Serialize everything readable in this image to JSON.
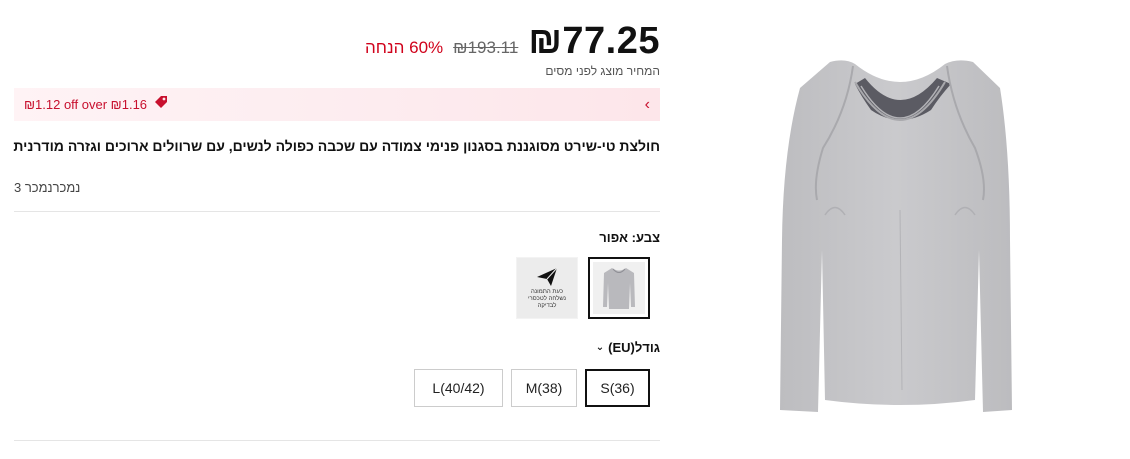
{
  "price": {
    "current": "₪77.25",
    "original": "₪193.11",
    "discount": "60% הנחה",
    "tax_note": "המחיר מוצג לפני מסים"
  },
  "promo": {
    "text": "₪1.12 off over ₪1.16"
  },
  "product": {
    "title": "חולצת טי-שירט מסוגננת בסגנון פנימי צמודה עם שכבה כפולה לנשים, עם שרוולים ארוכים וגזרה מודרנית",
    "sold": "נמכרנמכר 3"
  },
  "color": {
    "label": "צבע: אפור",
    "swatch_caption": "כעת התמונה נשלחה לטכסרי לבדיקה"
  },
  "size": {
    "label": "גודל(EU)",
    "options": [
      "S(36)",
      "M(38)",
      "L(40/42)"
    ],
    "selected": "S(36)"
  },
  "colors": {
    "accent": "#d0021b",
    "promo_bg": "#fde6ea",
    "shirt": "#c4c4c4"
  }
}
